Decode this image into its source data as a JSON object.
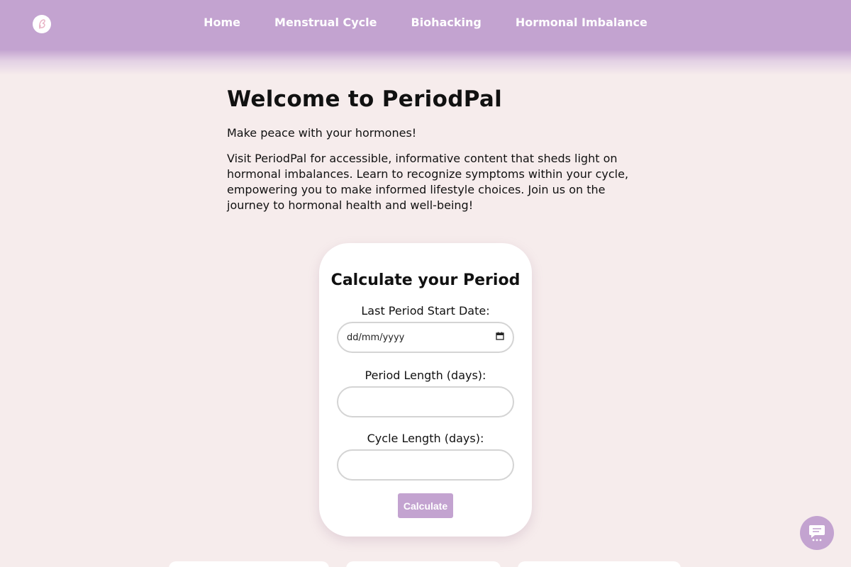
{
  "nav": {
    "logo_icon": "logo-icon",
    "links": [
      {
        "label": "Home"
      },
      {
        "label": "Menstrual Cycle"
      },
      {
        "label": "Biohacking"
      },
      {
        "label": "Hormonal Imbalance"
      }
    ]
  },
  "intro": {
    "title": "Welcome to PeriodPal",
    "tagline": "Make peace with your hormones!",
    "description": "Visit PeriodPal for accessible, informative content that sheds light on hormonal imbalances. Learn to recognize symptoms within your cycle, empowering you to make informed lifestyle choices. Join us on the journey to hormonal health and well-being!"
  },
  "calculator": {
    "title": "Calculate your Period",
    "last_period_label": "Last Period Start Date:",
    "last_period_placeholder": "dd/mm/yyyy",
    "period_length_label": "Period Length (days):",
    "period_length_value": "",
    "cycle_length_label": "Cycle Length (days):",
    "cycle_length_value": "",
    "button_label": "Calculate"
  },
  "chat": {
    "icon": "chat-icon"
  },
  "colors": {
    "nav_bg": "#c3a3d0",
    "page_bg": "#f6ecec",
    "card_bg": "#ffffff",
    "accent": "#c3a3d0"
  }
}
